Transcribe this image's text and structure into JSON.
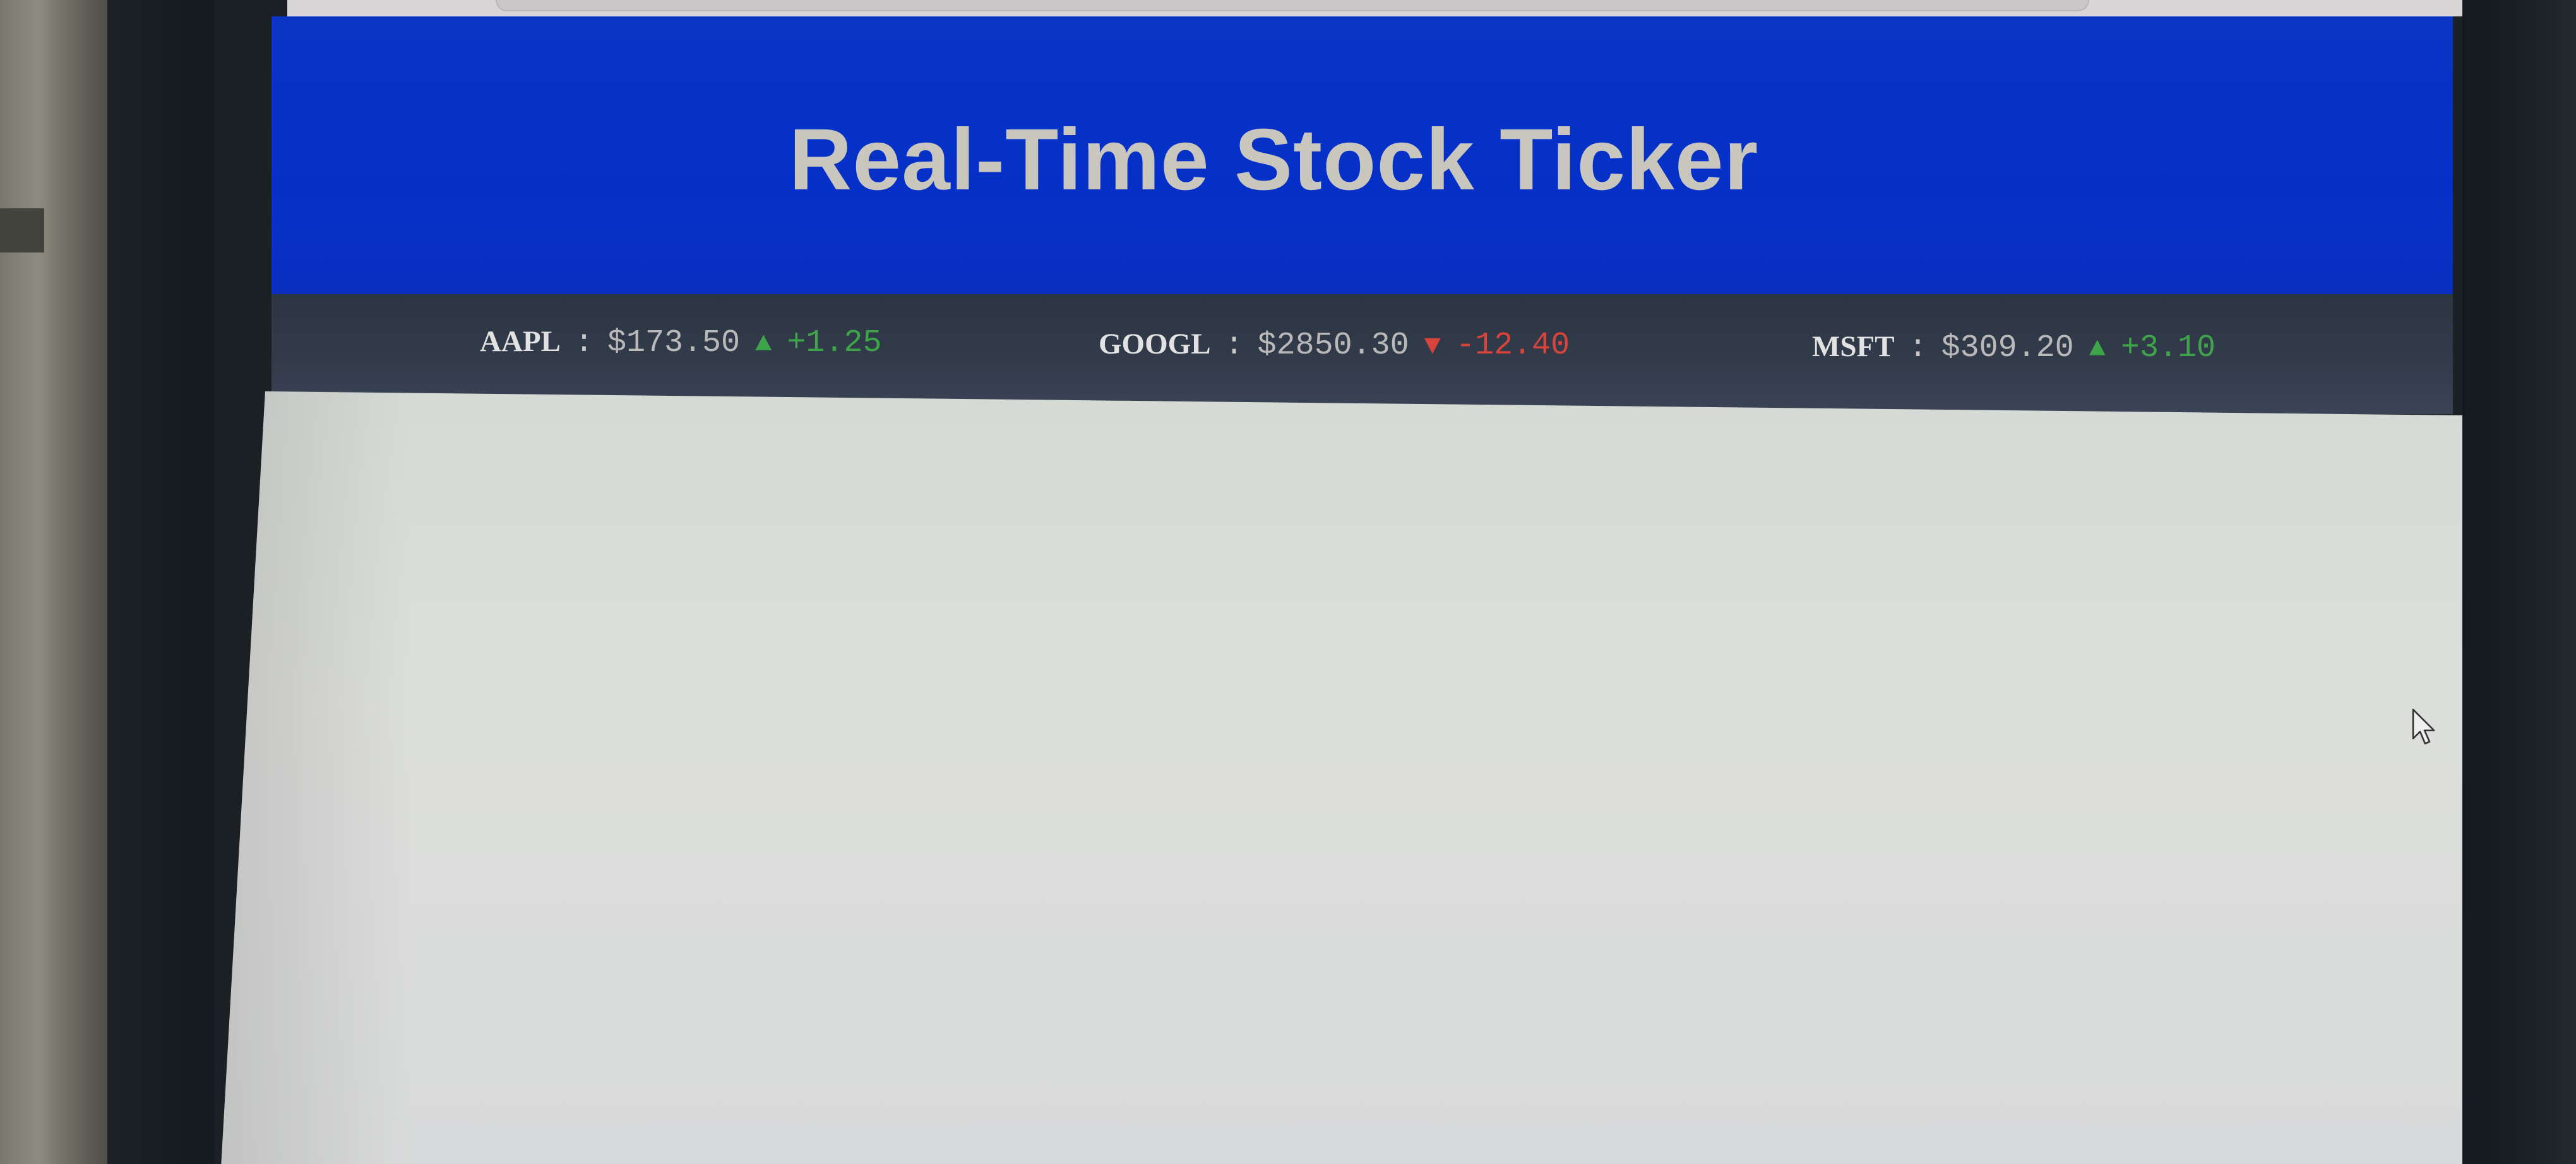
{
  "page": {
    "title": "Real-Time Stock Ticker"
  },
  "ticker": {
    "separator": ":",
    "items": [
      {
        "symbol": "AAPL",
        "price": "$173.50",
        "direction": "up",
        "arrow": "▲",
        "change": "+1.25"
      },
      {
        "symbol": "GOOGL",
        "price": "$2850.30",
        "direction": "down",
        "arrow": "▼",
        "change": "-12.40"
      },
      {
        "symbol": "MSFT",
        "price": "$309.20",
        "direction": "up",
        "arrow": "▲",
        "change": "+3.10"
      }
    ]
  },
  "colors": {
    "header_bg": "#0530c8",
    "title_text": "#c9c6be",
    "ticker_bg": "#323b4a",
    "up": "#3fa34a",
    "down": "#d9443a",
    "content_bg": "#dcdedb"
  },
  "icons": {
    "up_arrow": "triangle-up-icon",
    "down_arrow": "triangle-down-icon",
    "cursor": "mouse-pointer-icon"
  }
}
